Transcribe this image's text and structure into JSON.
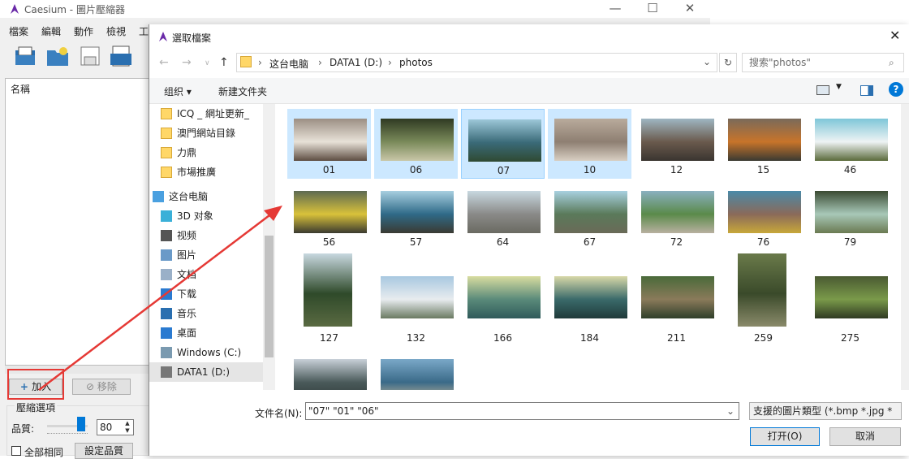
{
  "app": {
    "title": "Caesium - 圖片壓縮器",
    "window_controls": {
      "minimize": "—",
      "maximize": "☐",
      "close": "✕"
    },
    "menu": [
      "檔案",
      "編輯",
      "動作",
      "檢視",
      "工"
    ],
    "list_header": "名稱",
    "add_label": "加入",
    "remove_label": "移除",
    "options_title": "壓縮選項",
    "quality_label": "品質:",
    "quality_value": "80",
    "same_label": "全部相同",
    "set_quality_label": "設定品質"
  },
  "dialog": {
    "title": "選取檔案",
    "breadcrumb": [
      "这台电脑",
      "DATA1 (D:)",
      "photos"
    ],
    "search_placeholder": "搜索\"photos\"",
    "organize_label": "组织 ▾",
    "new_folder_label": "新建文件夹",
    "nav_items": [
      {
        "label": "ICQ _ 網址更新_",
        "icon": "folder-icon"
      },
      {
        "label": "澳門網站目錄",
        "icon": "folder-icon"
      },
      {
        "label": "力鼎",
        "icon": "folder-icon"
      },
      {
        "label": "市場推廣",
        "icon": "folder-icon"
      },
      {
        "label": "这台电脑",
        "icon": "computer-icon"
      },
      {
        "label": "3D 对象",
        "icon": "3d-objects-icon"
      },
      {
        "label": "视频",
        "icon": "video-icon"
      },
      {
        "label": "图片",
        "icon": "pictures-icon"
      },
      {
        "label": "文档",
        "icon": "documents-icon"
      },
      {
        "label": "下载",
        "icon": "download-icon"
      },
      {
        "label": "音乐",
        "icon": "music-icon"
      },
      {
        "label": "桌面",
        "icon": "desktop-icon"
      },
      {
        "label": "Windows (C:)",
        "icon": "windows-drive-icon"
      },
      {
        "label": "DATA1 (D:)",
        "icon": "drive-icon"
      }
    ],
    "files": [
      {
        "name": "01",
        "selected": true,
        "orientation": "land",
        "colors": [
          "#9c8f84",
          "#e8e2d8",
          "#5d4d42"
        ]
      },
      {
        "name": "06",
        "selected": true,
        "orientation": "land",
        "colors": [
          "#2f3a22",
          "#7a8a5a",
          "#c9c7a8"
        ]
      },
      {
        "name": "07",
        "selected": true,
        "current": true,
        "orientation": "land",
        "colors": [
          "#9cc7d8",
          "#3a6a78",
          "#2f4a32"
        ]
      },
      {
        "name": "10",
        "selected": true,
        "orientation": "land",
        "colors": [
          "#b9ab9c",
          "#8e7f72",
          "#d8cfc3"
        ]
      },
      {
        "name": "12",
        "selected": false,
        "orientation": "land",
        "colors": [
          "#9fb6c2",
          "#6a5a4d",
          "#3a3530"
        ]
      },
      {
        "name": "15",
        "selected": false,
        "orientation": "land",
        "colors": [
          "#7a6a5a",
          "#c8742a",
          "#3a3a32"
        ]
      },
      {
        "name": "46",
        "selected": false,
        "orientation": "land",
        "colors": [
          "#7fc6d8",
          "#eef3f4",
          "#5a6a3a"
        ]
      },
      {
        "name": "56",
        "selected": false,
        "orientation": "land",
        "colors": [
          "#5d6a52",
          "#d9c23a",
          "#3a3a30"
        ]
      },
      {
        "name": "57",
        "selected": false,
        "orientation": "land",
        "colors": [
          "#a8cfe0",
          "#2f6a88",
          "#3a3a32"
        ]
      },
      {
        "name": "64",
        "selected": false,
        "orientation": "land",
        "colors": [
          "#c8d8e0",
          "#8a8a88",
          "#6a6a62"
        ]
      },
      {
        "name": "67",
        "selected": false,
        "orientation": "land",
        "colors": [
          "#a8d0e0",
          "#5a7a5a",
          "#6a6a58"
        ]
      },
      {
        "name": "72",
        "selected": false,
        "orientation": "land",
        "colors": [
          "#8ab0c0",
          "#5a8a4a",
          "#b8b0a0"
        ]
      },
      {
        "name": "76",
        "selected": false,
        "orientation": "land",
        "colors": [
          "#4a8aa8",
          "#8a6a5a",
          "#c8a83a"
        ]
      },
      {
        "name": "79",
        "selected": false,
        "orientation": "land",
        "colors": [
          "#3a4a32",
          "#a8c8b8",
          "#6a7a52"
        ]
      },
      {
        "name": "127",
        "selected": false,
        "orientation": "port",
        "colors": [
          "#c8d8e0",
          "#2f4a2a",
          "#5a6a42"
        ]
      },
      {
        "name": "132",
        "selected": false,
        "orientation": "land",
        "colors": [
          "#a8c8e0",
          "#e8ecef",
          "#6a7a62"
        ]
      },
      {
        "name": "166",
        "selected": false,
        "orientation": "land",
        "colors": [
          "#d8dca0",
          "#5a8a7a",
          "#2f5a5a"
        ]
      },
      {
        "name": "184",
        "selected": false,
        "orientation": "land",
        "colors": [
          "#d8d8a8",
          "#3a6a6a",
          "#1f3a3a"
        ]
      },
      {
        "name": "211",
        "selected": false,
        "orientation": "land",
        "colors": [
          "#4a6a3a",
          "#8a7a5a",
          "#2f3f2a"
        ]
      },
      {
        "name": "259",
        "selected": false,
        "orientation": "port",
        "colors": [
          "#6a7a4a",
          "#3a4a2a",
          "#8a8a6a"
        ]
      },
      {
        "name": "275",
        "selected": false,
        "orientation": "land",
        "colors": [
          "#4a5a32",
          "#7a9a4a",
          "#2f3a22"
        ]
      },
      {
        "name": "",
        "selected": false,
        "orientation": "land",
        "colors": [
          "#c8d0d8",
          "#4a5a5a",
          "#2f3a3a"
        ]
      },
      {
        "name": "",
        "selected": false,
        "orientation": "land",
        "colors": [
          "#7aa8c8",
          "#3a6a88",
          "#c8b89a"
        ]
      }
    ],
    "filename_label": "文件名(N):",
    "filename_value": "\"07\" \"01\" \"06\"",
    "filetype_value": "支援的圖片類型 (*.bmp *.jpg *",
    "open_label": "打开(O)",
    "cancel_label": "取消"
  },
  "colors": {
    "selection": "#cce8ff",
    "accent": "#0078d7",
    "annotation": "#e53935",
    "folder": "#ffd768"
  }
}
